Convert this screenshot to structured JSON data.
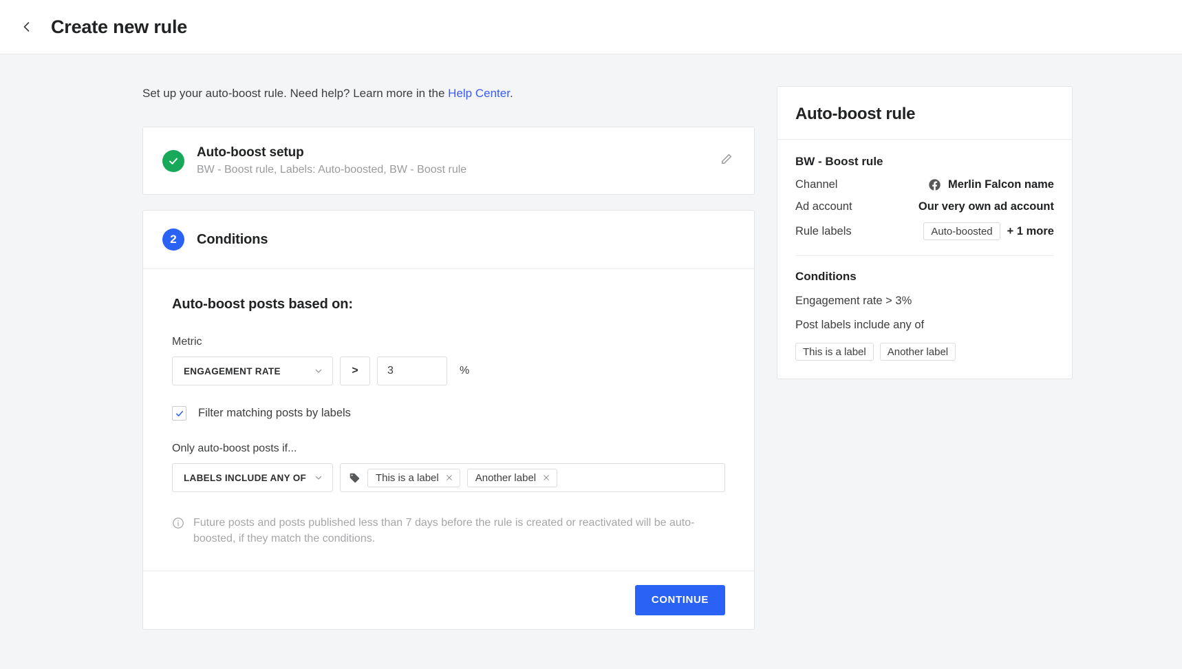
{
  "header": {
    "back_icon": "chevron-left-icon",
    "title": "Create new rule"
  },
  "intro": {
    "text_before": "Set up your auto-boost rule. Need help? Learn more in the ",
    "link_text": "Help Center",
    "text_after": "."
  },
  "steps": {
    "setup": {
      "status_icon": "check-circle-icon",
      "title": "Auto-boost setup",
      "subtitle": "BW - Boost rule, Labels: Auto-boosted, BW - Boost rule",
      "edit_icon": "pencil-icon"
    },
    "conditions": {
      "number": "2",
      "title": "Conditions",
      "section_heading": "Auto-boost posts based on:",
      "metric_label": "Metric",
      "metric_value": "ENGAGEMENT RATE",
      "operator": ">",
      "threshold_value": "3",
      "threshold_placeholder": "0",
      "unit": "%",
      "filter_checkbox_label": "Filter matching posts by labels",
      "filter_checkbox_checked": true,
      "only_if_label": "Only auto-boost posts if...",
      "labels_condition_value": "LABELS INCLUDE ANY OF",
      "label_chips": [
        "This is a label",
        "Another label"
      ],
      "tag_icon": "tag-icon",
      "note_icon": "info-icon",
      "note_text": "Future posts and posts published less than 7 days before the rule is created or reactivated will be auto-boosted, if they match the conditions.",
      "continue_label": "CONTINUE"
    }
  },
  "summary": {
    "title": "Auto-boost rule",
    "rule_name": "BW - Boost rule",
    "rows": [
      {
        "key": "Channel",
        "value": "Merlin Falcon name",
        "icon": "facebook-icon"
      },
      {
        "key": "Ad account",
        "value": "Our very own ad account",
        "icon": ""
      }
    ],
    "rule_labels_key": "Rule labels",
    "rule_labels_chip": "Auto-boosted",
    "rule_labels_more": "+ 1 more",
    "conditions_title": "Conditions",
    "condition_metric_line": "Engagement rate > 3%",
    "condition_labels_line": "Post labels include any of",
    "condition_chips": [
      "This is a label",
      "Another label"
    ]
  },
  "colors": {
    "accent_blue": "#2b62f6",
    "success_green": "#17a85a",
    "link_blue": "#3b5bf5",
    "page_bg": "#f4f5f6"
  }
}
